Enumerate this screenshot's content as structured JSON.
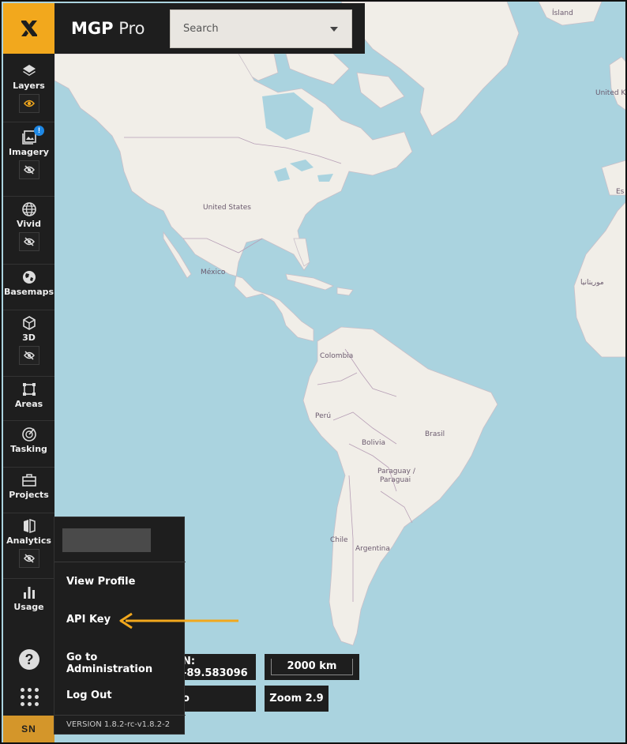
{
  "app": {
    "logo_icon": "x-logo-icon",
    "title_bold": "MGP",
    "title_light": " Pro",
    "accent": "#f2a81d"
  },
  "search": {
    "placeholder": "Search"
  },
  "sidebar": {
    "items": [
      {
        "label": "Layers",
        "icon": "layers-icon",
        "toggle": "eye-icon"
      },
      {
        "label": "Imagery",
        "icon": "imagery-icon",
        "toggle": "eye-off-icon",
        "badge": "!"
      },
      {
        "label": "Vivid",
        "icon": "globe-icon",
        "toggle": "eye-off-icon"
      },
      {
        "label": "Basemaps",
        "icon": "basemap-globe-icon"
      },
      {
        "label": "3D",
        "icon": "cube-icon",
        "toggle": "eye-off-icon"
      },
      {
        "label": "Areas",
        "icon": "area-square-icon"
      },
      {
        "label": "Tasking",
        "icon": "tasking-icon"
      },
      {
        "label": "Projects",
        "icon": "briefcase-icon"
      },
      {
        "label": "Analytics",
        "icon": "analytics-icon",
        "toggle": "eye-off-icon"
      },
      {
        "label": "Usage",
        "icon": "bar-chart-icon"
      }
    ],
    "help_glyph": "?",
    "user_initials": "SN"
  },
  "user_menu": {
    "items": [
      "View Profile",
      "API Key",
      "Go to Administration",
      "Log Out"
    ],
    "version": "VERSION 1.8.2-rc-v1.8.2-2"
  },
  "map": {
    "labels": {
      "island": "Ísland",
      "united_k": "United K",
      "united_states": "United States",
      "mexico": "México",
      "colombia": "Colombia",
      "peru": "Perú",
      "bolivia": "Bolivia",
      "brasil": "Brasil",
      "paraguay_1": "Paraguay /",
      "paraguay_2": "Paraguai",
      "chile": "Chile",
      "argentina": "Argentina",
      "morocco": "موريتانيا",
      "es": "Es"
    },
    "controls": {
      "coordinate": "N: -89.583096",
      "scale": "2000 km",
      "zoom": "Zoom 2.9",
      "partial": "o"
    }
  }
}
